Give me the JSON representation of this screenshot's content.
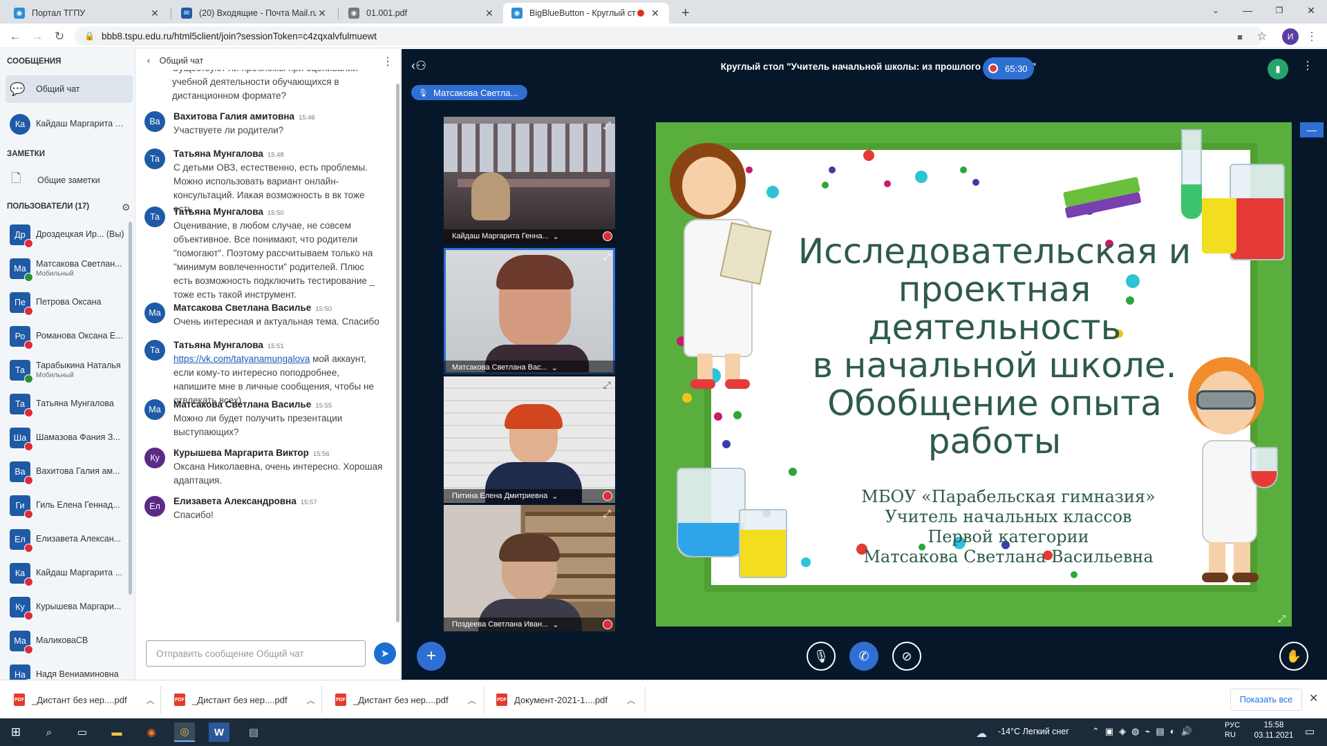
{
  "browser": {
    "tabs": [
      {
        "label": "Портал ТГПУ",
        "icon": "globe-icon"
      },
      {
        "label": "(20) Входящие - Почта Mail.ru",
        "icon": "mail-icon"
      },
      {
        "label": "01.001.pdf",
        "icon": "globe-icon"
      },
      {
        "label": "BigBlueButton - Круглый ст",
        "icon": "bbb-icon"
      }
    ],
    "new_tab": "+",
    "url": "bbb8.tspu.edu.ru/html5client/join?sessionToken=c4zqxalvfulmuewt",
    "profile_initial": "И"
  },
  "sidebar": {
    "messages_heading": "СООБЩЕНИЯ",
    "public_chat": "Общий чат",
    "private_chat": {
      "initials": "Ка",
      "name": "Кайдаш Маргарита Г..."
    },
    "notes_heading": "ЗАМЕТКИ",
    "shared_notes": "Общие заметки",
    "users_heading": "ПОЛЬЗОВАТЕЛИ (17)",
    "users": [
      {
        "initials": "Др",
        "name": "Дроздецкая Ир... (Вы)",
        "sub": "",
        "mic": "muted"
      },
      {
        "initials": "Ма",
        "name": "Матсакова Светлан...",
        "sub": "Мобильный",
        "mic": "talking"
      },
      {
        "initials": "Пе",
        "name": "Петрова Оксана",
        "sub": "",
        "mic": "muted"
      },
      {
        "initials": "Ро",
        "name": "Романова Оксана Е...",
        "sub": "",
        "mic": "muted"
      },
      {
        "initials": "Та",
        "name": "Тарабыкина Наталья",
        "sub": "Мобильный",
        "mic": "talking"
      },
      {
        "initials": "Та",
        "name": "Татьяна Мунгалова",
        "sub": "",
        "mic": "muted"
      },
      {
        "initials": "Ша",
        "name": "Шамазова Фания З...",
        "sub": "",
        "mic": "muted"
      },
      {
        "initials": "Ва",
        "name": "Вахитова Галия ам...",
        "sub": "",
        "mic": "muted"
      },
      {
        "initials": "Ги",
        "name": "Гиль Елена Геннад...",
        "sub": "",
        "mic": "muted"
      },
      {
        "initials": "Ел",
        "name": "Елизавета Алексан...",
        "sub": "",
        "mic": "muted"
      },
      {
        "initials": "Ка",
        "name": "Кайдаш Маргарита ...",
        "sub": "",
        "mic": "muted"
      },
      {
        "initials": "Ку",
        "name": "Курышева Маргари...",
        "sub": "",
        "mic": "muted"
      },
      {
        "initials": "Ма",
        "name": "МаликоваСВ",
        "sub": "",
        "mic": "muted"
      },
      {
        "initials": "На",
        "name": "Надя Вениаминовна",
        "sub": "",
        "mic": "muted"
      }
    ]
  },
  "chat": {
    "title": "Общий чат",
    "partial_top": "Существуют ли проблемы при оценивании учебной деятельности обучающихся в дистанционном формате?",
    "messages": [
      {
        "initials": "Ва",
        "color": "#1f5aa6",
        "author": "Вахитова Галия амитовна",
        "time": "15:46",
        "text": "Участвуете ли родители?"
      },
      {
        "initials": "Та",
        "color": "#1f5aa6",
        "author": "Татьяна Мунгалова",
        "time": "15:48",
        "text": "С детьми ОВЗ, естественно, есть проблемы. Можно использовать вариант онлайн-консультаций. Иакая возможность в вк тоже есть"
      },
      {
        "initials": "Та",
        "color": "#1f5aa6",
        "author": "Татьяна Мунгалова",
        "time": "15:50",
        "text": "Оценивание, в любом случае, не совсем объективное. Все понимают, что родители \"помогают\". Поэтому рассчитываем только на \"минимум вовлеченности\" родителей. Плюс есть возможность подключить тестирование _ тоже есть такой инструмент."
      },
      {
        "initials": "Ма",
        "color": "#1f5aa6",
        "author": "Матсакова Светлана Василье",
        "time": "15:50",
        "text": "Очень интересная и актуальная тема. Спасибо"
      },
      {
        "initials": "Та",
        "color": "#1f5aa6",
        "author": "Татьяна Мунгалова",
        "time": "15:51",
        "link": "https://vk.com/tatyanamungalova",
        "text": " мой аккаунт, если кому-то интересно поподробнее, напишите мне в личные сообщения, чтобы не отвлекать всех)"
      },
      {
        "initials": "Ма",
        "color": "#1f5aa6",
        "author": "Матсакова Светлана Василье",
        "time": "15:55",
        "text": "Можно ли будет получить презентации выступающих?"
      },
      {
        "initials": "Ку",
        "color": "#5b2a86",
        "author": "Курышева Маргарита Виктор",
        "time": "15:56",
        "text": "Оксана Николаевна, очень интересно. Хорошая адаптация."
      },
      {
        "initials": "Ел",
        "color": "#5b2a86",
        "author": "Елизавета Александровна",
        "time": "15:57",
        "text": "Спасибо!"
      }
    ],
    "input_placeholder": "Отправить сообщение Общий чат"
  },
  "meeting": {
    "title": "Круглый стол \"Учитель начальной школы: из прошлого в будущее\"",
    "recording_time": "65:30",
    "talking_indicator": "Матсакова Светла...",
    "videos": [
      {
        "name": "Кайдаш Маргарита Генна..."
      },
      {
        "name": "Матсакова Светлана Вас..."
      },
      {
        "name": "Питина Елена Дмитриевна"
      },
      {
        "name": "Поздеева Светлана Иван..."
      }
    ]
  },
  "slide": {
    "title_lines": [
      "Исследовательская и",
      "проектная деятельность",
      "в начальной школе.",
      "Обобщение опыта работы"
    ],
    "subtitle_lines": [
      "МБОУ «Парабельская гимназия»",
      "Учитель начальных классов",
      "Первой категории",
      "Матсакова Светлана Васильевна"
    ]
  },
  "downloads": {
    "items": [
      "_Дистант без нер....pdf",
      "_Дистант без нер....pdf",
      "_Дистант без нер....pdf",
      "Документ-2021-1....pdf"
    ],
    "show_all": "Показать все"
  },
  "taskbar": {
    "weather": "-14°C  Легкий снег",
    "lang_top": "РУС",
    "lang_bottom": "RU",
    "time": "15:58",
    "date": "03.11.2021"
  },
  "colors": {
    "accent": "#1b6fd1",
    "meeting_bg": "#06172a",
    "muted_red": "#de2b39",
    "talking_green": "#2a8f3d"
  }
}
